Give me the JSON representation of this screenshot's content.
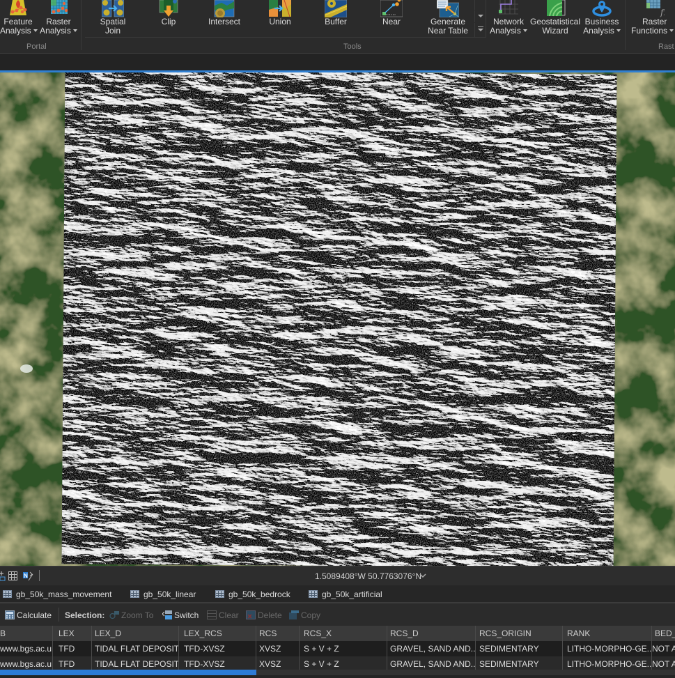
{
  "ribbon": {
    "portal_group": {
      "label": "Portal",
      "buttons": [
        {
          "name": "feature-analysis",
          "line1": "Feature",
          "line2": "Analysis",
          "dropdown": true
        },
        {
          "name": "raster-analysis",
          "line1": "Raster",
          "line2": "Analysis",
          "dropdown": true
        }
      ]
    },
    "tools_group": {
      "label": "Tools",
      "buttons": [
        {
          "name": "spatial-join",
          "line1": "Spatial",
          "line2": "Join"
        },
        {
          "name": "clip",
          "line1": "Clip",
          "line2": ""
        },
        {
          "name": "intersect",
          "line1": "Intersect",
          "line2": ""
        },
        {
          "name": "union",
          "line1": "Union",
          "line2": ""
        },
        {
          "name": "buffer",
          "line1": "Buffer",
          "line2": ""
        },
        {
          "name": "near",
          "line1": "Near",
          "line2": ""
        },
        {
          "name": "generate-near-table",
          "line1": "Generate",
          "line2": "Near Table"
        }
      ]
    },
    "workflows": {
      "buttons": [
        {
          "name": "network-analysis",
          "line1": "Network",
          "line2": "Analysis",
          "dropdown": true
        },
        {
          "name": "geostatistical-wizard",
          "line1": "Geostatistical",
          "line2": "Wizard",
          "dropdown": false
        },
        {
          "name": "business-analysis",
          "line1": "Business",
          "line2": "Analysis",
          "dropdown": true
        }
      ]
    },
    "raster_group": {
      "label": "Rast",
      "buttons": [
        {
          "name": "raster-functions",
          "line1": "Raster",
          "line2": "Functions",
          "dropdown": true
        }
      ]
    }
  },
  "map": {
    "layer": "hillshade raster over satellite imagery basemap",
    "coordinates": "1.5089408°W 50.7763076°N"
  },
  "table_tabs": [
    {
      "label": "gb_50k_mass_movement"
    },
    {
      "label": "gb_50k_linear"
    },
    {
      "label": "gb_50k_bedrock"
    },
    {
      "label": "gb_50k_artificial"
    }
  ],
  "table_toolbar": {
    "calculate": "Calculate",
    "selection_label": "Selection:",
    "zoom_to": "Zoom To",
    "switch": "Switch",
    "clear": "Clear",
    "delete": "Delete",
    "copy": "Copy"
  },
  "attribute_table": {
    "columns": [
      "B",
      "LEX",
      "LEX_D",
      "LEX_RCS",
      "RCS",
      "RCS_X",
      "RCS_D",
      "RCS_ORIGIN",
      "RANK",
      "BED_E"
    ],
    "rows": [
      [
        "www.bgs.ac.u...",
        "TFD",
        "TIDAL FLAT DEPOSITS",
        "TFD-XVSZ",
        "XVSZ",
        "S + V + Z",
        "GRAVEL, SAND AND...",
        "SEDIMENTARY",
        "LITHO-MORPHO-GE...",
        "NOT A"
      ],
      [
        "www.bgs.ac.u...",
        "TFD",
        "TIDAL FLAT DEPOSITS",
        "TFD-XVSZ",
        "XVSZ",
        "S + V + Z",
        "GRAVEL, SAND AND...",
        "SEDIMENTARY",
        "LITHO-MORPHO-GE...",
        "NOT A"
      ]
    ],
    "horizontal_scroll_position": 0.38
  },
  "colors": {
    "accent_blue": "#2f7fd1",
    "ribbon_bg": "#2b2b2b",
    "text": "#dcdcdc",
    "disabled_text": "#6a6a6a"
  }
}
